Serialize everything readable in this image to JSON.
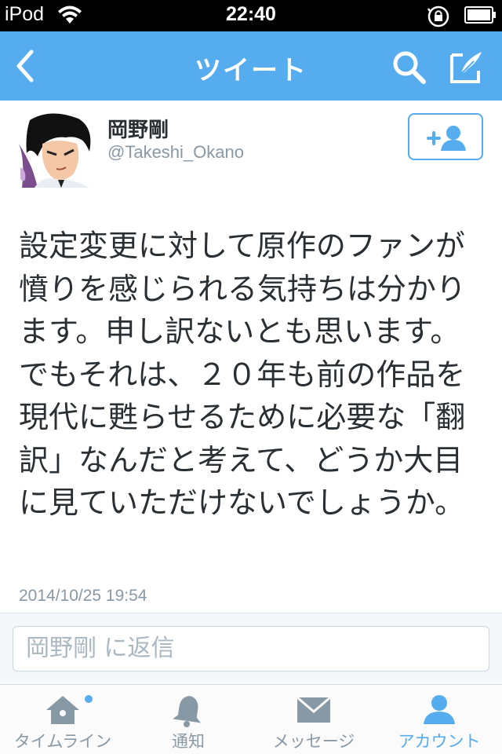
{
  "status_bar": {
    "device": "iPod",
    "time": "22:40"
  },
  "nav": {
    "title": "ツイート",
    "icons": [
      "back-chevron-icon",
      "search-icon",
      "compose-icon"
    ]
  },
  "tweet": {
    "user_name": "岡野剛",
    "user_handle": "@Takeshi_Okano",
    "text": "設定変更に対して原作のファンが憤りを感じられる気持ちは分かります。申し訳ないとも思います。でもそれは、２０年も前の作品を現代に甦らせるために必要な「翻訳」なんだと考えて、どうか大目に見ていただけないでしょうか。",
    "timestamp": "2014/10/25 19:54",
    "follow_icon": "add-user-icon"
  },
  "reply": {
    "placeholder": "岡野剛 に返信"
  },
  "tabs": [
    {
      "label": "タイムライン",
      "icon": "home-icon",
      "active": false,
      "has_badge": true
    },
    {
      "label": "通知",
      "icon": "bell-icon",
      "active": false,
      "has_badge": false
    },
    {
      "label": "メッセージ",
      "icon": "envelope-icon",
      "active": false,
      "has_badge": false
    },
    {
      "label": "アカウント",
      "icon": "person-icon",
      "active": true,
      "has_badge": false
    }
  ],
  "colors": {
    "accent": "#55acee",
    "status_bar": "#000000",
    "text": "#292f33",
    "muted": "#8899a6"
  }
}
